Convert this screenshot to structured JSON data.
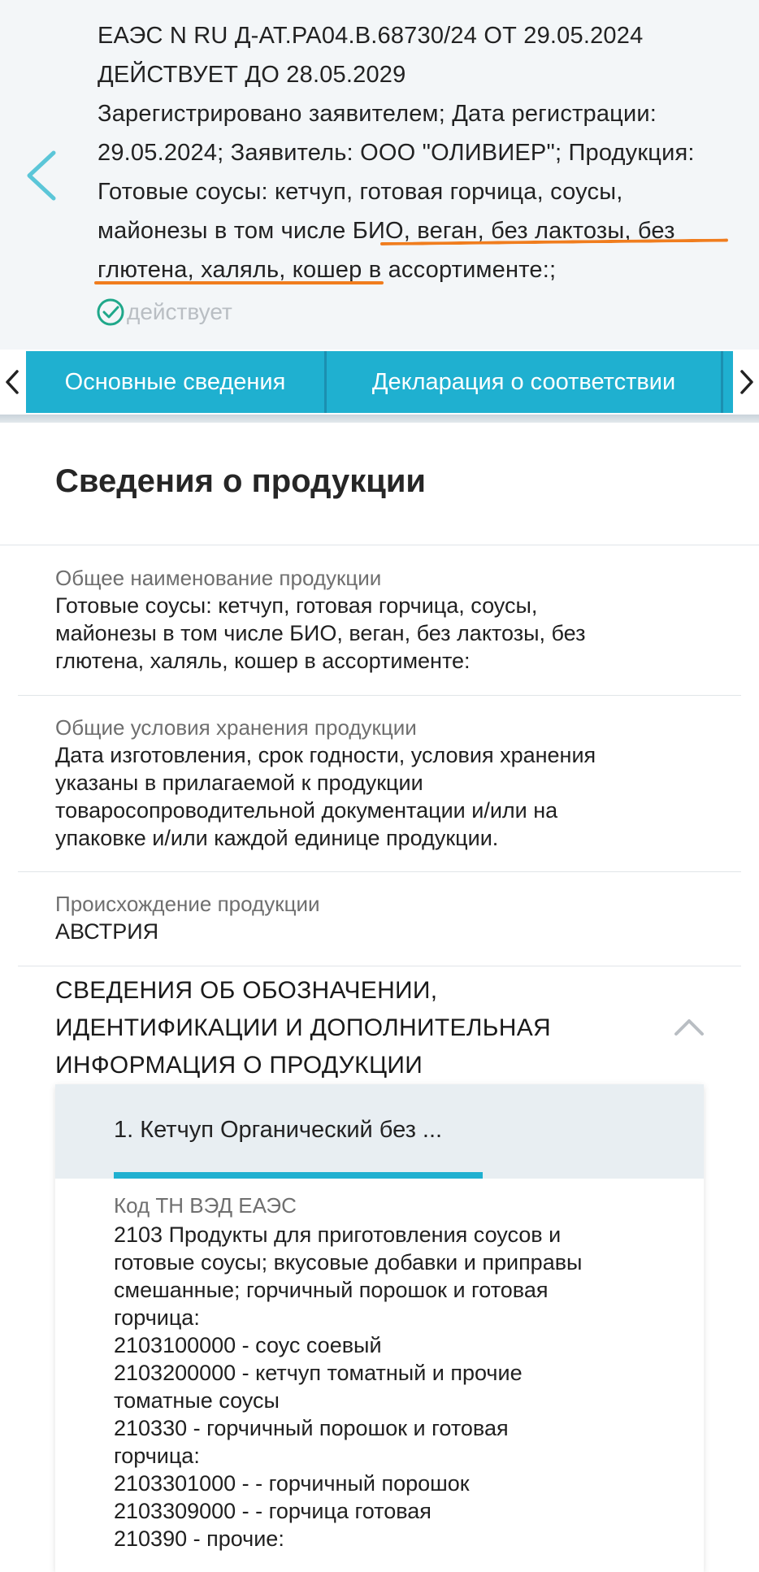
{
  "header": {
    "lines": [
      "ЕАЭС N RU Д-AT.PA04.B.68730/24 ОТ 29.05.2024",
      "ДЕЙСТВУЕТ ДО 28.05.2029",
      "Зарегистрировано заявителем; Дата регистрации:",
      "29.05.2024; Заявитель: ООО \"ОЛИВИЕР\"; Продукция:",
      "Готовые соусы: кетчуп, готовая горчица, соусы,",
      "майонезы в том числе БИО, веган, без лактозы, без",
      "глютена, халяль, кошер в ассортименте:;"
    ],
    "status": "действует",
    "status_color": "#1fa88a",
    "highlight_color": "#f07d1e"
  },
  "tabs": {
    "items": [
      {
        "label": "Основные сведения"
      },
      {
        "label": "Декларация о соответствии"
      }
    ],
    "accent": "#1fb0d0"
  },
  "section_title": "Сведения о продукции",
  "fields": [
    {
      "label": "Общее наименование продукции",
      "value_lines": [
        "Готовые соусы: кетчуп, готовая горчица, соусы,",
        "майонезы в том числе БИО, веган, без лактозы, без",
        "глютена, халяль, кошер в ассортименте:"
      ]
    },
    {
      "label": "Общие условия хранения продукции",
      "value_lines": [
        "Дата изготовления, срок годности, условия хранения",
        "указаны в прилагаемой к продукции",
        "товаросопроводительной документации и/или на",
        "упаковке и/или каждой единице продукции."
      ]
    },
    {
      "label": "Происхождение продукции",
      "value_lines": [
        "АВСТРИЯ"
      ]
    }
  ],
  "identification_section": {
    "title_lines": [
      "СВЕДЕНИЯ ОБ ОБОЗНАЧЕНИИ,",
      "ИДЕНТИФИКАЦИИ И ДОПОЛНИТЕЛЬНАЯ",
      "ИНФОРМАЦИЯ О ПРОДУКЦИИ"
    ],
    "item": {
      "title": "1. Кетчуп Органический без ...",
      "label": "Код ТН ВЭД ЕАЭС",
      "value_lines": [
        "2103 Продукты для приготовления соусов и",
        "готовые соусы; вкусовые добавки и приправы",
        "смешанные; горчичный порошок и готовая",
        "горчица:",
        "2103100000 - соус соевый",
        "2103200000 - кетчуп томатный и прочие",
        "томатные соусы",
        "210330 - горчичный порошок и готовая",
        "горчица:",
        "2103301000 - - горчичный порошок",
        "2103309000 - - горчица готовая",
        "210390 - прочие:"
      ]
    }
  }
}
